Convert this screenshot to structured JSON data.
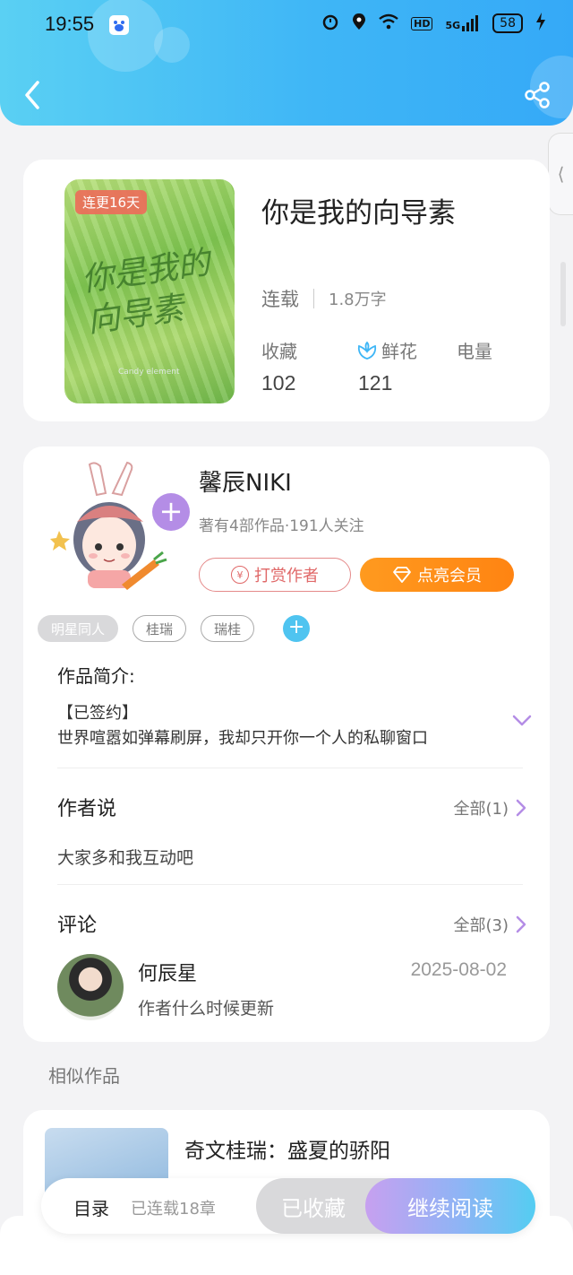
{
  "status_bar": {
    "time": "19:55",
    "battery": "58",
    "network": "5G",
    "hd": "HD"
  },
  "book": {
    "cover_badge": "连更16天",
    "cover_title": "你是我的向导素",
    "cover_subtitle": "Candy element",
    "title": "你是我的向导素",
    "status": "连载",
    "word_count": "1.8万字",
    "stats": {
      "favorites_label": "收藏",
      "favorites_value": "102",
      "flowers_label": "鲜花",
      "flowers_value": "121",
      "power_label": "电量"
    }
  },
  "author": {
    "name": "馨辰NIKI",
    "stats": "著有4部作品·191人关注",
    "reward_label": "打赏作者",
    "reward_icon": "¥",
    "vip_label": "点亮会员",
    "follow_icon": "+",
    "tags": [
      "明星同人",
      "桂瑞",
      "瑞桂"
    ],
    "tag_add": "+"
  },
  "intro": {
    "label": "作品简介:",
    "line1": "【已签约】",
    "line2": "世界喧嚣如弹幕刷屏，我却只开你一个人的私聊窗口"
  },
  "author_says": {
    "label": "作者说",
    "more": "全部(1)",
    "text": "大家多和我互动吧"
  },
  "comments": {
    "label": "评论",
    "more": "全部(3)",
    "items": [
      {
        "name": "何辰星",
        "date": "2025-08-02",
        "text": "作者什么时候更新"
      }
    ]
  },
  "similar": {
    "label": "相似作品",
    "items": [
      {
        "title": "奇文桂瑞：盛夏的骄阳"
      }
    ]
  },
  "bottom_bar": {
    "toc": "目录",
    "chapters": "已连载18章",
    "favorited": "已收藏",
    "continue": "继续阅读"
  },
  "side_tab": "⟨",
  "colors": {
    "header_start": "#5ad0f3",
    "header_end": "#35a9f7",
    "vip": "#ff8f18",
    "reward": "#e06868",
    "accent_purple": "#b48de6"
  }
}
